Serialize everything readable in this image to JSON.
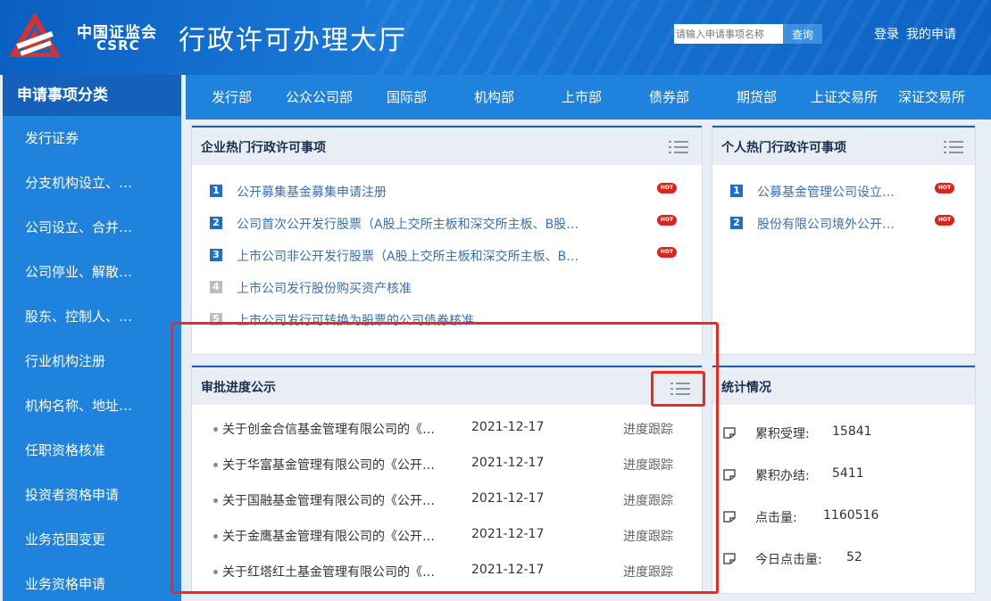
{
  "header": {
    "logo_cn": "中国证监会",
    "logo_en": "CSRC",
    "title": "行政许可办理大厅",
    "search_placeholder": "请输入申请事项名称",
    "search_button": "查询",
    "login": "登录",
    "my_applications": "我的申请"
  },
  "sidebar": {
    "title": "申请事项分类",
    "items": [
      "发行证券",
      "分支机构设立、…",
      "公司设立、合并…",
      "公司停业、解散…",
      "股东、控制人、…",
      "行业机构注册",
      "机构名称、地址…",
      "任职资格核准",
      "投资者资格申请",
      "业务范围变更",
      "业务资格申请"
    ]
  },
  "nav": [
    "发行部",
    "公众公司部",
    "国际部",
    "机构部",
    "上市部",
    "债券部",
    "期货部",
    "上证交易所",
    "深证交易所"
  ],
  "enterprise_hot": {
    "title": "企业热门行政许可事项",
    "items": [
      {
        "rank": "1",
        "text": "公开募集基金募集申请注册",
        "hot": true
      },
      {
        "rank": "2",
        "text": "公司首次公开发行股票（A股上交所主板和深交所主板、B股…",
        "hot": true
      },
      {
        "rank": "3",
        "text": "上市公司非公开发行股票（A股上交所主板和深交所主板、B…",
        "hot": true
      },
      {
        "rank": "4",
        "text": "上市公司发行股份购买资产核准",
        "hot": false
      },
      {
        "rank": "5",
        "text": "上市公司发行可转换为股票的公司债券核准",
        "hot": false
      }
    ]
  },
  "personal_hot": {
    "title": "个人热门行政许可事项",
    "items": [
      {
        "rank": "1",
        "text": "公募基金管理公司设立…",
        "hot": true
      },
      {
        "rank": "2",
        "text": "股份有限公司境外公开…",
        "hot": true
      }
    ]
  },
  "hot_badge_label": "HOT",
  "progress": {
    "title": "审批进度公示",
    "rows": [
      {
        "name": "关于创金合信基金管理有限公司的《…",
        "date": "2021-12-17",
        "action": "进度跟踪"
      },
      {
        "name": "关于华富基金管理有限公司的《公开…",
        "date": "2021-12-17",
        "action": "进度跟踪"
      },
      {
        "name": "关于国融基金管理有限公司的《公开…",
        "date": "2021-12-17",
        "action": "进度跟踪"
      },
      {
        "name": "关于金鹰基金管理有限公司的《公开…",
        "date": "2021-12-17",
        "action": "进度跟踪"
      },
      {
        "name": "关于红塔红土基金管理有限公司的《…",
        "date": "2021-12-17",
        "action": "进度跟踪"
      }
    ]
  },
  "stats": {
    "title": "统计情况",
    "rows": [
      {
        "label": "累积受理:",
        "value": "15841"
      },
      {
        "label": "累积办结:",
        "value": "5411"
      },
      {
        "label": "点击量:",
        "value": "1160516"
      },
      {
        "label": "今日点击量:",
        "value": "52"
      }
    ]
  },
  "colors": {
    "brand_blue": "#1f82dd",
    "highlight_red": "#f0281e",
    "hot_red": "#d9251c"
  }
}
